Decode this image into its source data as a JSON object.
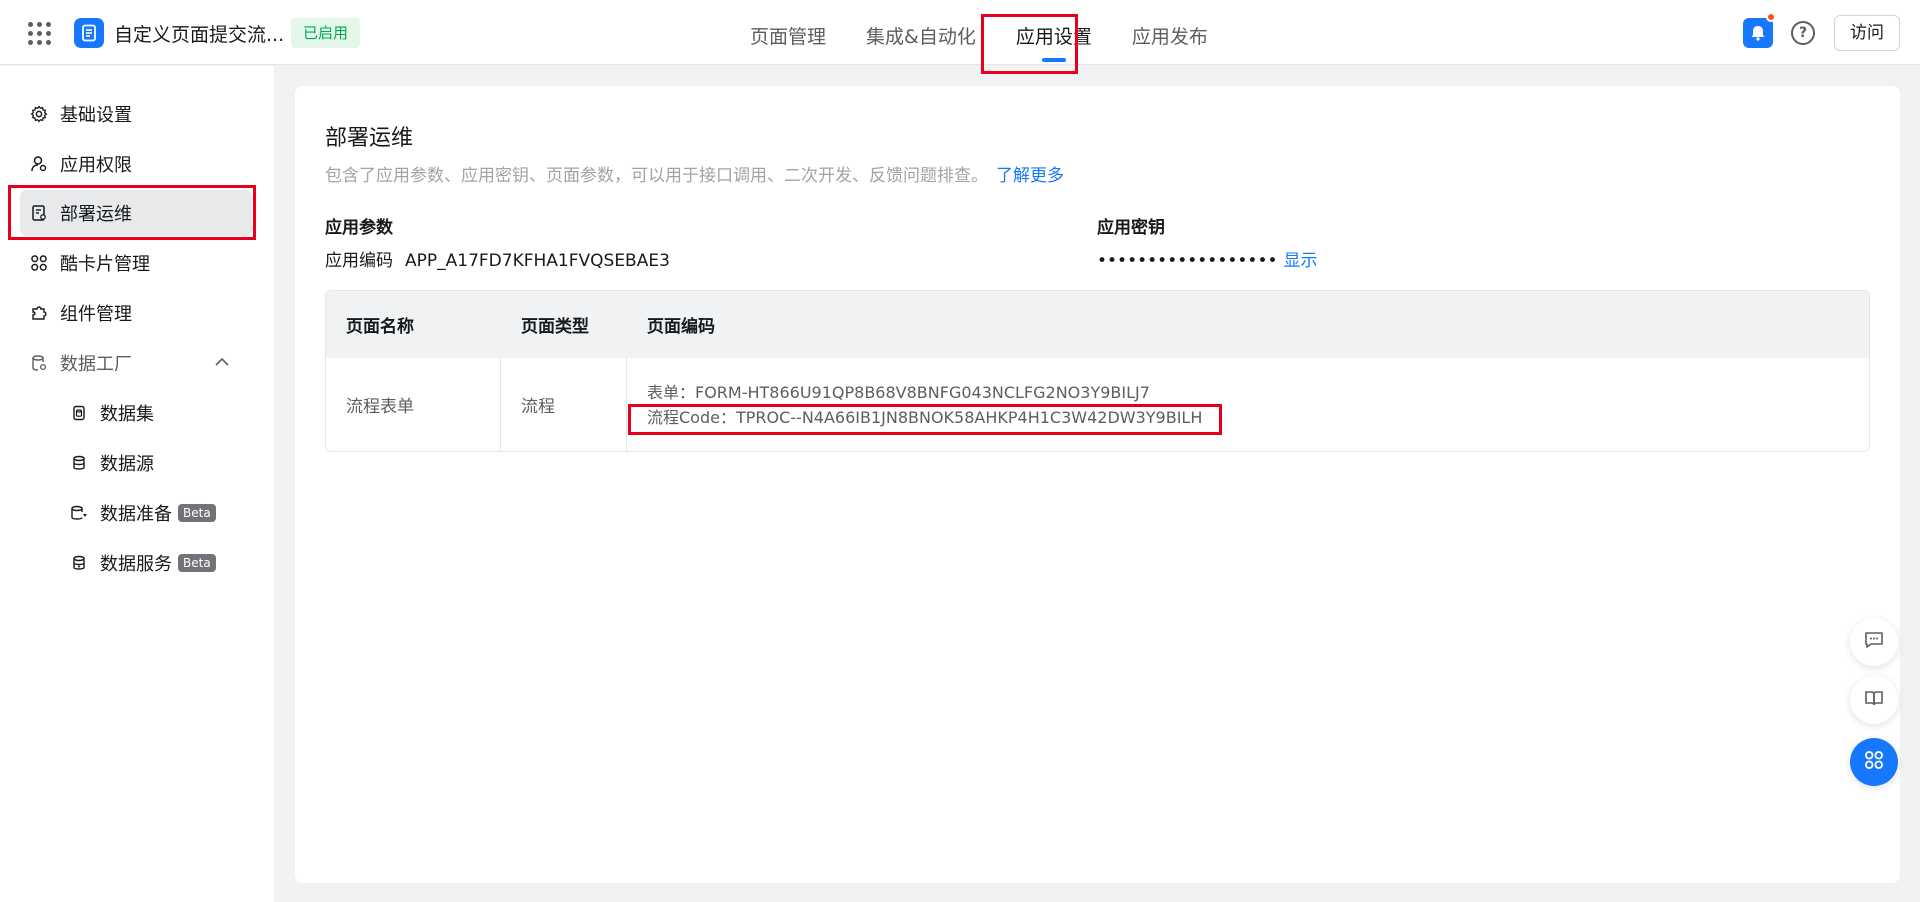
{
  "header": {
    "app_title": "自定义页面提交流...",
    "status_badge": "已启用",
    "nav_tabs": [
      {
        "label": "页面管理"
      },
      {
        "label": "集成&自动化"
      },
      {
        "label": "应用设置"
      },
      {
        "label": "应用发布"
      }
    ],
    "help_symbol": "?",
    "visit_label": "访问"
  },
  "sidebar": {
    "items": [
      {
        "label": "基础设置",
        "icon": "gear-icon"
      },
      {
        "label": "应用权限",
        "icon": "user-lock-icon"
      },
      {
        "label": "部署运维",
        "icon": "ops-doc-icon"
      },
      {
        "label": "酷卡片管理",
        "icon": "cards-icon"
      },
      {
        "label": "组件管理",
        "icon": "puzzle-icon"
      },
      {
        "label": "数据工厂",
        "icon": "data-factory-icon"
      }
    ],
    "sub_items": [
      {
        "label": "数据集",
        "icon": "dataset-icon"
      },
      {
        "label": "数据源",
        "icon": "database-icon"
      },
      {
        "label": "数据准备",
        "icon": "data-prep-icon",
        "badge": "Beta"
      },
      {
        "label": "数据服务",
        "icon": "data-service-icon",
        "badge": "Beta"
      }
    ]
  },
  "main": {
    "title": "部署运维",
    "description": "包含了应用参数、应用密钥、页面参数，可以用于接口调用、二次开发、反馈问题排查。",
    "learn_more": "了解更多",
    "params_label": "应用参数",
    "app_code_key": "应用编码",
    "app_code_value": "APP_A17FD7KFHA1FVQSEBAE3",
    "secret_label": "应用密钥",
    "secret_masked": "••••••••••••••••••",
    "secret_show": "显示",
    "table": {
      "headers": [
        "页面名称",
        "页面类型",
        "页面编码"
      ],
      "row": {
        "name": "流程表单",
        "type": "流程",
        "form_code": "表单：FORM-HT866U91QP8B68V8BNFG043NCLFG2NO3Y9BILJ7",
        "process_code": "流程Code：TPROC--N4A66IB1JN8BNOK58AHKP4H1C3W42DW3Y9BILH"
      }
    }
  },
  "colors": {
    "accent": "#1677ff",
    "highlight": "#e6001e",
    "success": "#00a854"
  }
}
